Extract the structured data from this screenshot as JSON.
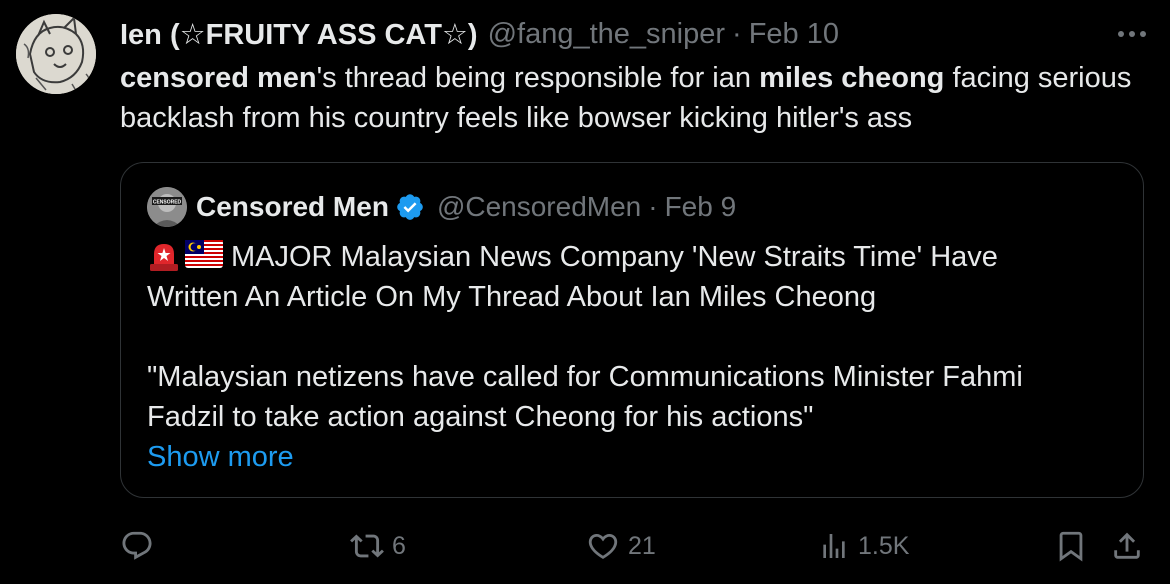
{
  "author": {
    "display_name": "Ien (☆FRUITY ASS CAT☆)",
    "handle": "@fang_the_sniper",
    "separator": "·",
    "date": "Feb 10"
  },
  "tweet": {
    "part1": "censored men",
    "part2": "'s thread being responsible for ian ",
    "part3": "miles cheong",
    "part4": " facing serious backlash from his country feels like bowser kicking hitler's ass"
  },
  "quote": {
    "display_name": "Censored Men",
    "handle": "@CensoredMen",
    "separator": "·",
    "date": "Feb 9",
    "avatar_label": "CENSORED",
    "emoji": [
      "rotating-light-icon",
      "malaysia-flag-icon"
    ],
    "line1": "MAJOR Malaysian News Company 'New Straits Time' Have",
    "line2": "Written An Article On My Thread About Ian Miles Cheong",
    "line3": "\"Malaysian netizens have called for Communications Minister Fahmi",
    "line4": "Fadzil to take action against Cheong for his actions\"",
    "show_more": "Show more"
  },
  "actions": {
    "replies": "",
    "reposts": "6",
    "likes": "21",
    "views": "1.5K"
  },
  "colors": {
    "background": "#000000",
    "text": "#e7e9ea",
    "muted": "#71767b",
    "border": "#2f3336",
    "link": "#1d9bf0",
    "verified": "#1d9bf0"
  }
}
